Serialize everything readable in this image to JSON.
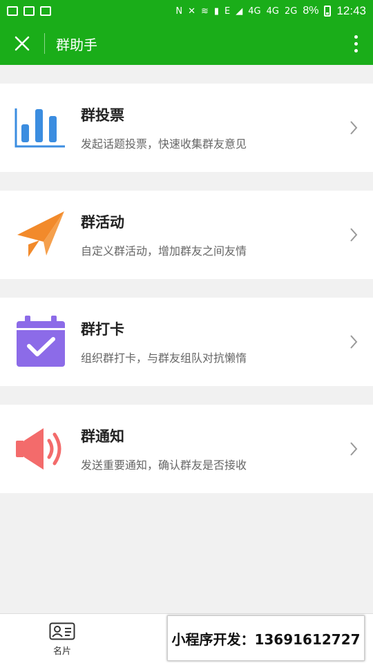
{
  "status_bar": {
    "battery_percent": "8%",
    "time": "12:43",
    "network_labels": [
      "4G",
      "4G",
      "2G",
      "E"
    ]
  },
  "nav": {
    "title": "群助手"
  },
  "items": [
    {
      "title": "群投票",
      "desc": "发起话题投票，快速收集群友意见",
      "icon": "bar-chart-icon",
      "color": "#3b8de0"
    },
    {
      "title": "群活动",
      "desc": "自定义群活动，增加群友之间友情",
      "icon": "paper-plane-icon",
      "color": "#f28a2b"
    },
    {
      "title": "群打卡",
      "desc": "组织群打卡，与群友组队对抗懒惰",
      "icon": "calendar-check-icon",
      "color": "#8c6be8"
    },
    {
      "title": "群通知",
      "desc": "发送重要通知，确认群友是否接收",
      "icon": "speaker-icon",
      "color": "#f36b6b"
    }
  ],
  "tabbar": {
    "card_label": "名片"
  },
  "watermark": {
    "text": "小程序开发：13691612727"
  },
  "colors": {
    "brand": "#1aad19",
    "background": "#f1f1f1"
  }
}
